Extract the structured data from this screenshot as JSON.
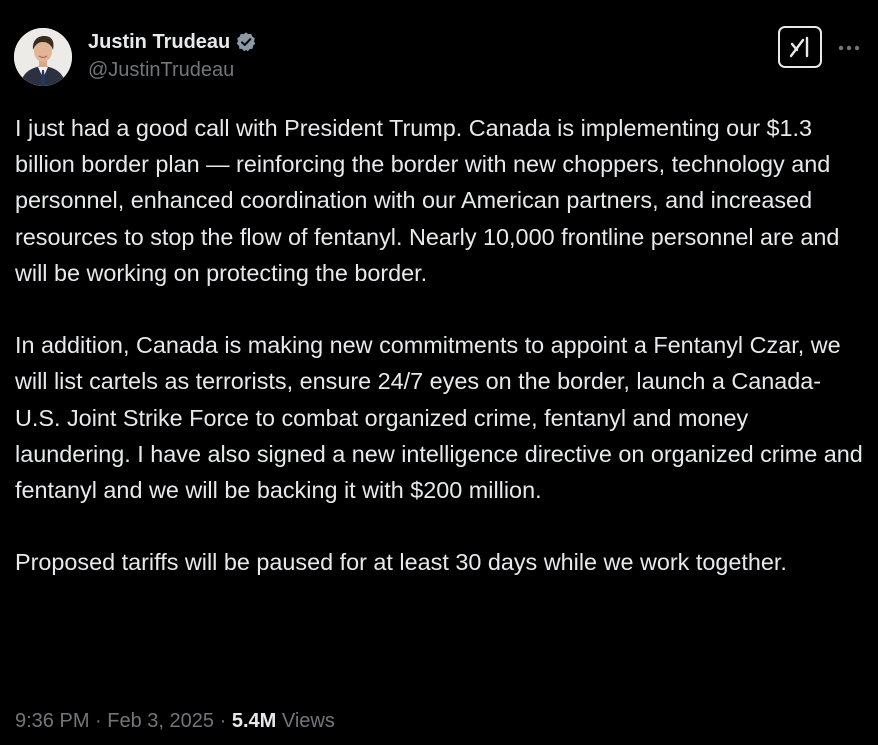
{
  "author": {
    "display_name": "Justin Trudeau",
    "handle": "@JustinTrudeau",
    "verified_icon": "verified-badge-icon",
    "verified_color": "#8b98a5"
  },
  "header_actions": {
    "grok_icon": "grok-icon",
    "more_icon": "more-options-icon"
  },
  "tweet": {
    "paragraphs": [
      "I just had a good call with President Trump. Canada is implementing our $1.3 billion border plan — reinforcing the border with new choppers, technology and personnel, enhanced coordination with our American partners, and increased resources to stop the flow of fentanyl. Nearly 10,000 frontline personnel are and will be working on protecting the border.",
      "In addition, Canada is making new commitments to appoint a Fentanyl Czar, we will list cartels as terrorists, ensure 24/7 eyes on the border, launch a Canada- U.S. Joint Strike Force to combat organized crime, fentanyl and money laundering. I have also signed a new intelligence directive on organized crime and fentanyl and we will be backing it with $200 million.",
      "Proposed tariffs will be paused for at least 30 days while we work together."
    ]
  },
  "meta": {
    "time": "9:36 PM",
    "separator": "·",
    "date": "Feb 3, 2025",
    "views_count": "5.4M",
    "views_label": "Views"
  },
  "colors": {
    "background": "#000000",
    "primary_text": "#e7e9ea",
    "secondary_text": "#71767b"
  }
}
